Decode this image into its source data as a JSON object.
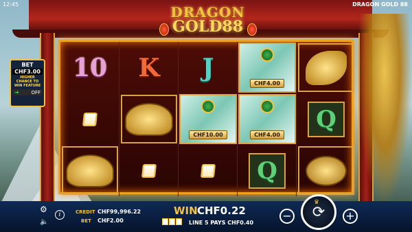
{
  "status": {
    "time": "12:45",
    "game_title": "DRAGON GOLD 88"
  },
  "logo": {
    "line1": "DRAGON",
    "line2": "GOLD88"
  },
  "bet_panel": {
    "title": "BET",
    "value": "CHF3.00",
    "description": "HIGHER CHANCE TO WIN FEATURE",
    "toggle": "OFF"
  },
  "reels": [
    [
      "10",
      "scatter",
      "tortoise"
    ],
    [
      "K",
      "tortoise",
      "scatter"
    ],
    [
      "J",
      "CHF10.00",
      "scatter"
    ],
    [
      "CHF4.00",
      "CHF4.00",
      "Q"
    ],
    [
      "fish",
      "Q",
      "frog"
    ]
  ],
  "bottom": {
    "credit_label": "CREDIT",
    "credit_value": "CHF99,996.22",
    "bet_label": "BET",
    "bet_value": "CHF2.00",
    "win_label": "WIN",
    "win_value": "CHF0.22",
    "line_text": "LINE 5 PAYS CHF0.40"
  },
  "colors": {
    "accent": "#f2c241",
    "bar": "#0f2a55",
    "reel_border": "#f0a020"
  }
}
